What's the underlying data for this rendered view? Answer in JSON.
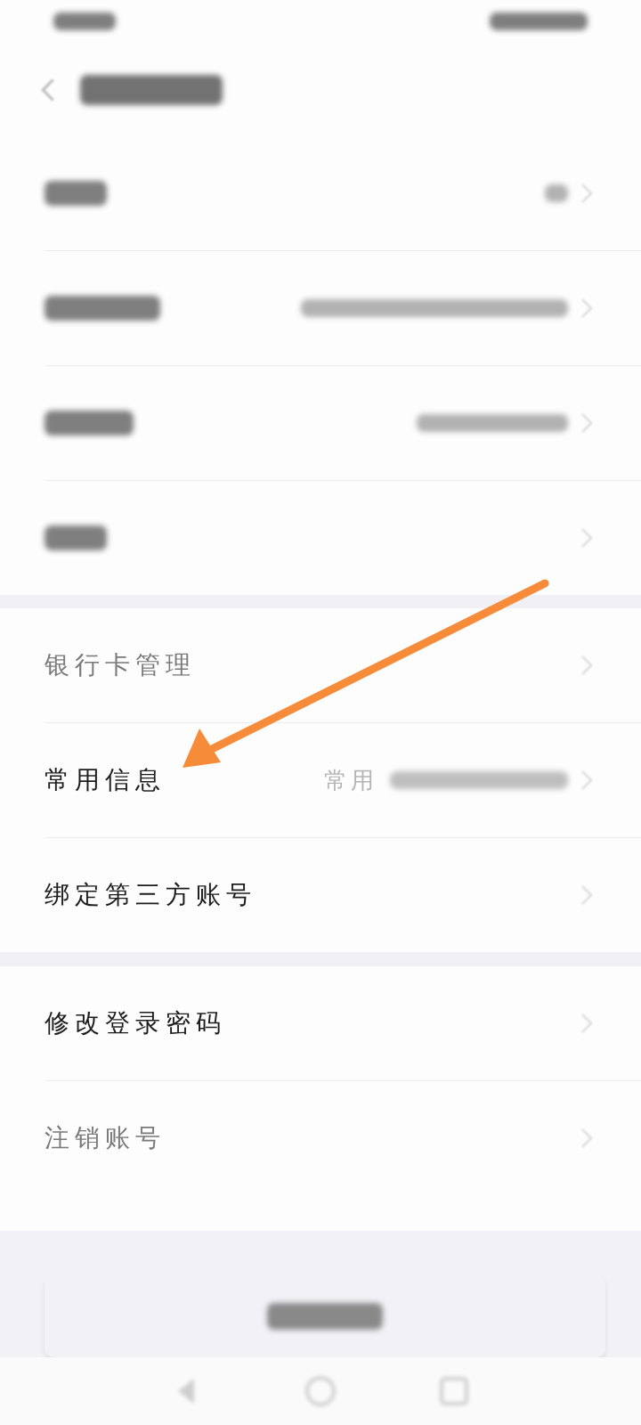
{
  "sections": [
    {
      "rows": [
        {
          "kind": "blurred"
        },
        {
          "kind": "blurred"
        },
        {
          "kind": "blurred"
        },
        {
          "kind": "blurred"
        }
      ]
    },
    {
      "rows": [
        {
          "kind": "text",
          "label": "银行卡管理",
          "dimmed": true
        },
        {
          "kind": "text",
          "label": "常用信息",
          "dimmed": false,
          "value": "常用"
        },
        {
          "kind": "text",
          "label": "绑定第三方账号",
          "dimmed": false
        }
      ]
    },
    {
      "rows": [
        {
          "kind": "text",
          "label": "修改登录密码",
          "dimmed": false
        },
        {
          "kind": "text",
          "label": "注销账号",
          "dimmed": true
        }
      ]
    }
  ],
  "annotation": {
    "kind": "arrow",
    "color": "#f68c3a"
  }
}
